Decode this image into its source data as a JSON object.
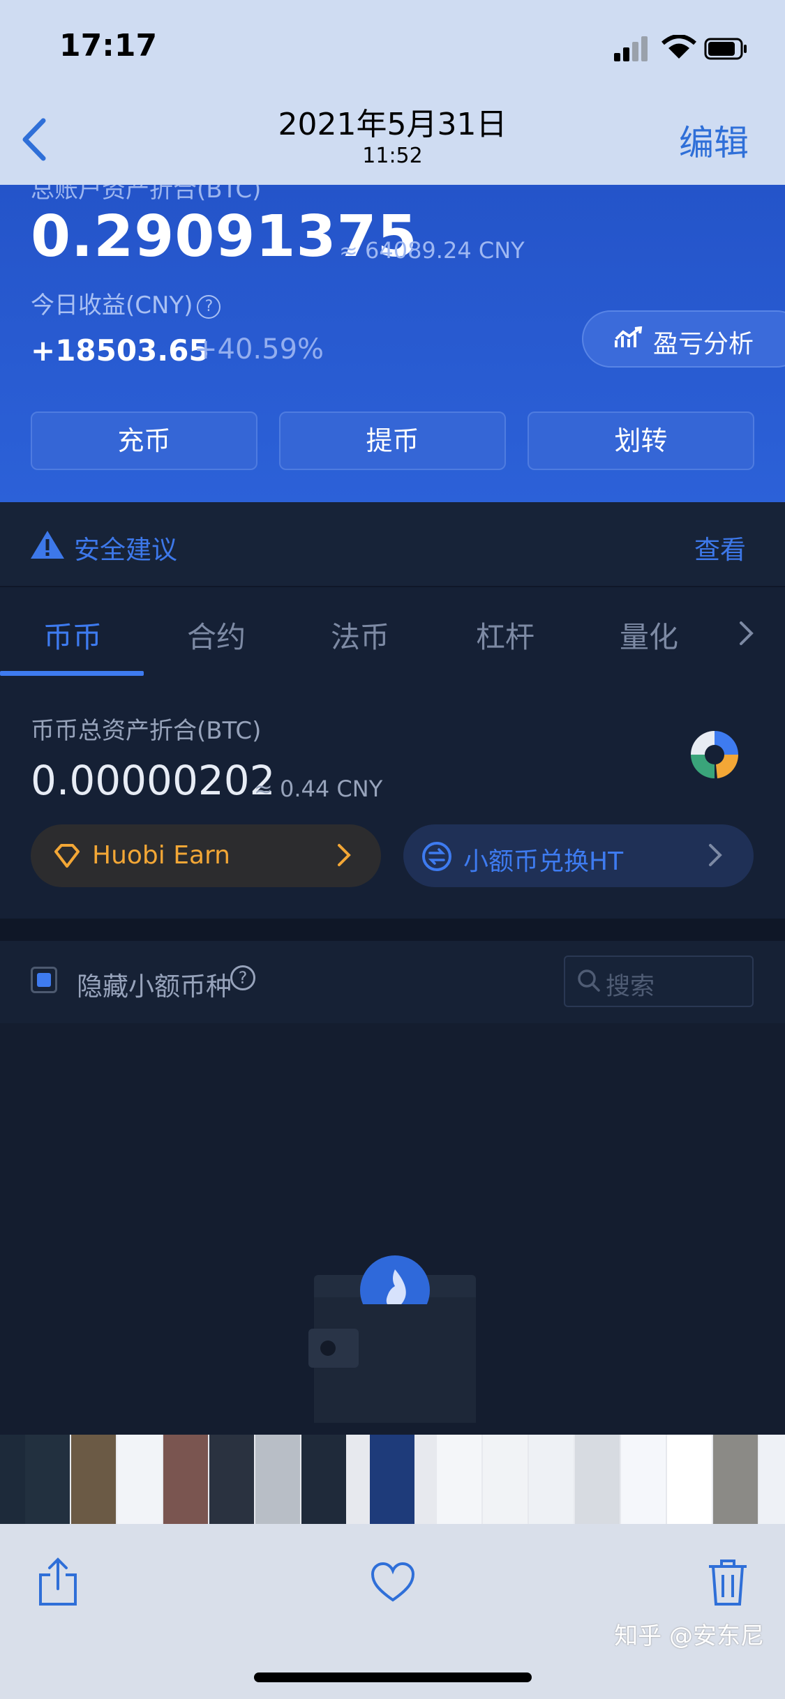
{
  "status": {
    "time": "17:17"
  },
  "header": {
    "date": "2021年5月31日",
    "time": "11:52",
    "edit": "编辑"
  },
  "assets": {
    "cut_label": "总账户资产折合(BTC)",
    "total_btc": "0.29091375",
    "total_cny": "≈ 64089.24 CNY",
    "income_label": "今日收益(CNY)",
    "help": "?",
    "income": "+18503.65",
    "income_pct": "+40.59%",
    "pl_analysis": "盈亏分析",
    "actions": [
      "充币",
      "提币",
      "划转"
    ]
  },
  "security": {
    "label": "安全建议",
    "view": "查看"
  },
  "tabs": [
    "币币",
    "合约",
    "法币",
    "杠杆",
    "量化"
  ],
  "summary": {
    "label": "币币总资产折合(BTC)",
    "value": "0.00000202",
    "approx": "≈ 0.44 CNY",
    "earn": "Huobi Earn",
    "swap": "小额币兑换HT"
  },
  "filter": {
    "hide_small": "隐藏小额币种",
    "help": "?",
    "search_placeholder": "搜索"
  },
  "footer": {
    "watermark": "知乎 @安东尼"
  },
  "colors": {
    "accent": "#3e7bf0",
    "panel": "#2454c9",
    "bg": "#131c2d",
    "earn": "#f3a736"
  }
}
